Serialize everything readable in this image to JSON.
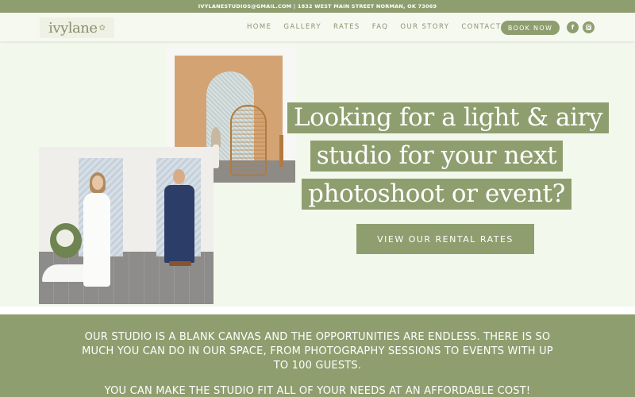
{
  "topbar": {
    "contact_line": "IVYLANESTUDIOS@GMAIL.COM | 1832 WEST MAIN STREET NORMAN, OK 73069"
  },
  "header": {
    "logo_text": "ivylane",
    "nav": [
      "HOME",
      "GALLERY",
      "RATES",
      "FAQ",
      "OUR STORY",
      "CONTACT"
    ],
    "book_label": "BOOK NOW",
    "social": [
      {
        "icon": "facebook-icon",
        "glyph": "f"
      },
      {
        "icon": "instagram-icon",
        "glyph": ""
      }
    ]
  },
  "hero": {
    "headline_lines": [
      "Looking for a light & airy",
      "studio for your next",
      "photoshoot or event?"
    ],
    "cta_label": "VIEW OUR RENTAL RATES"
  },
  "about": {
    "paragraph_1": "OUR STUDIO IS A BLANK CANVAS AND THE OPPORTUNITIES ARE ENDLESS. THERE IS SO MUCH YOU CAN DO IN OUR SPACE, FROM PHOTOGRAPHY SESSIONS TO EVENTS WITH UP TO 100 GUESTS.",
    "paragraph_2": "YOU CAN MAKE THE STUDIO FIT ALL OF YOUR NEEDS AT AN AFFORDABLE COST!"
  },
  "colors": {
    "sage": "#8f9e6f",
    "background": "#f3f8ec",
    "white": "#ffffff"
  }
}
